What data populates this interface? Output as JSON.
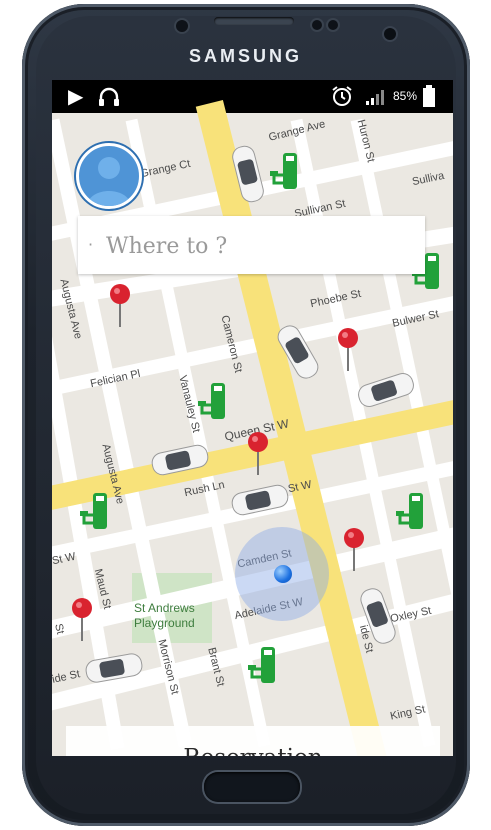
{
  "device": {
    "brand": "SAMSUNG"
  },
  "status_bar": {
    "battery_text": "85%",
    "icons": [
      "play-icon",
      "headphones-icon",
      "alarm-icon",
      "signal-icon",
      "battery-icon"
    ]
  },
  "search": {
    "placeholder": "Where to ?"
  },
  "reserve": {
    "label": "Reservation"
  },
  "map": {
    "streets": [
      "Grange Ave",
      "Huron St",
      "Sullivan St",
      "Sulliva",
      "Augusta Ave",
      "Phoebe St",
      "Bulwer St",
      "Cameron St",
      "Felician Pl",
      "Vanauley St",
      "Queen St W",
      "Rush Ln",
      "St W",
      "St W",
      "Camden St",
      "Adelaide St W",
      "Maud St",
      "Morrison St",
      "Brant St",
      "St Andrews",
      "Playground",
      "Oxley St",
      "Grange Ct",
      "Augusta Ave",
      "St",
      "ide St",
      "ide St",
      "King St"
    ]
  }
}
